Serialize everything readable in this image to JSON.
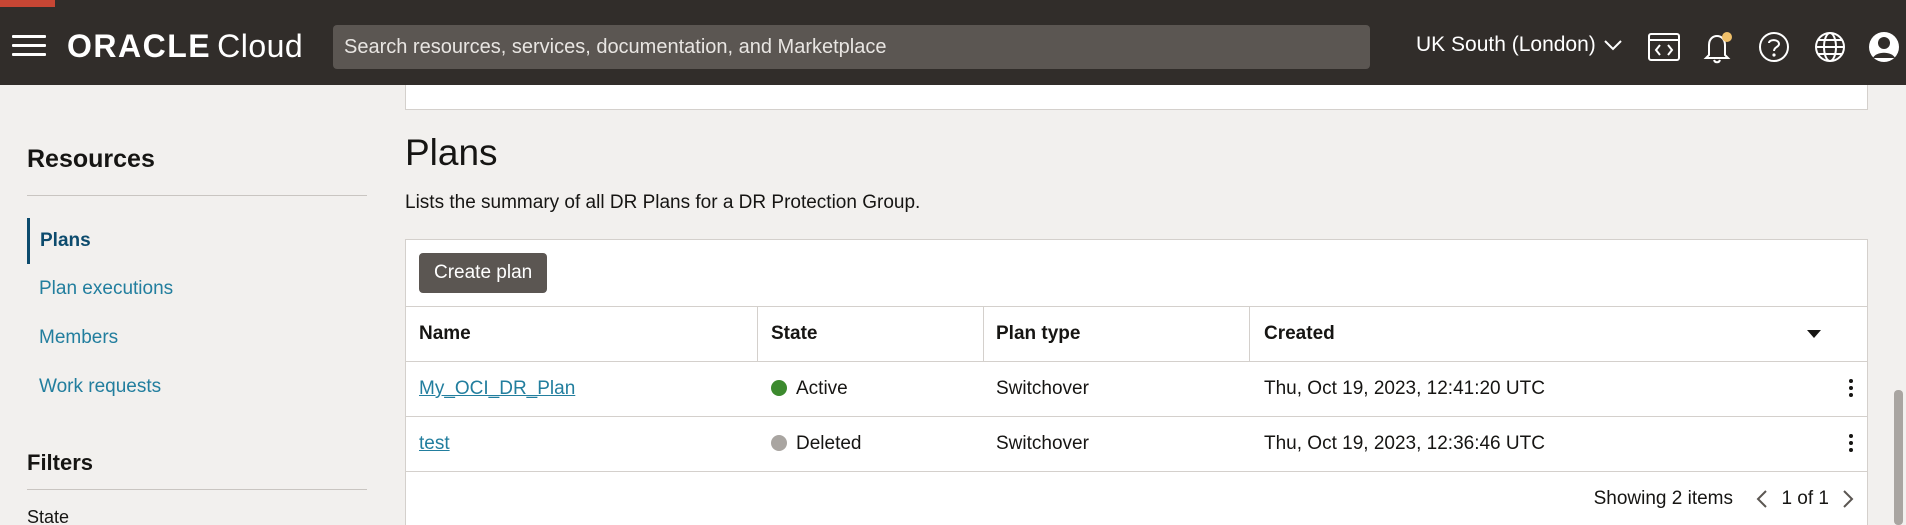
{
  "header": {
    "brand_oracle": "ORACLE",
    "brand_cloud": "Cloud",
    "search_placeholder": "Search resources, services, documentation, and Marketplace",
    "region": "UK South (London)",
    "icons": [
      "menu-icon",
      "cloud-shell-icon",
      "bell-icon",
      "help-icon",
      "globe-icon",
      "user-avatar-icon"
    ]
  },
  "sidebar": {
    "resources_heading": "Resources",
    "items": [
      {
        "label": "Plans",
        "active": true
      },
      {
        "label": "Plan executions"
      },
      {
        "label": "Members"
      },
      {
        "label": "Work requests"
      }
    ],
    "filters_heading": "Filters",
    "state_label": "State"
  },
  "main": {
    "title": "Plans",
    "description": "Lists the summary of all DR Plans for a DR Protection Group.",
    "create_button": "Create plan",
    "columns": [
      "Name",
      "State",
      "Plan type",
      "Created"
    ],
    "rows": [
      {
        "name": "My_OCI_DR_Plan",
        "state": "Active",
        "state_color": "#3c8a2e",
        "plan_type": "Switchover",
        "created": "Thu, Oct 19, 2023, 12:41:20 UTC"
      },
      {
        "name": "test",
        "state": "Deleted",
        "state_color": "#a9a5a1",
        "plan_type": "Switchover",
        "created": "Thu, Oct 19, 2023, 12:36:46 UTC"
      }
    ],
    "showing": "Showing 2 items",
    "page_indicator": "1 of 1"
  },
  "colors": {
    "header_bg": "#312d2a",
    "accent_red": "#c74634",
    "link": "#227e9e",
    "active_nav": "#0d4b6d",
    "button_bg": "#5b5652"
  }
}
